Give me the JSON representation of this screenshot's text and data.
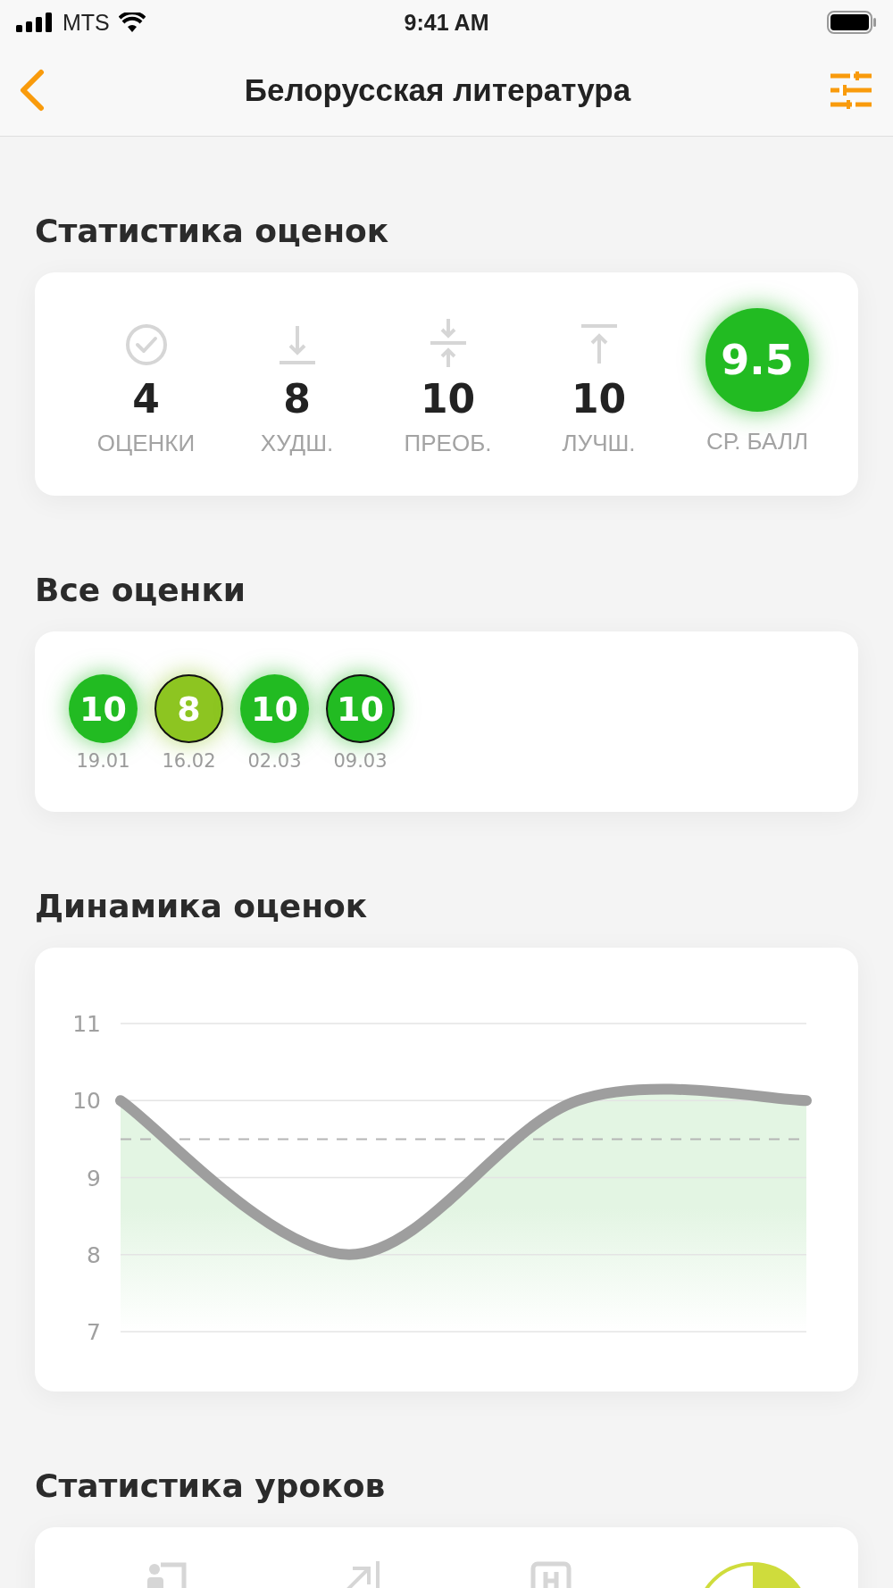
{
  "status_bar": {
    "carrier": "MTS",
    "time": "9:41 AM"
  },
  "nav": {
    "title": "Белорусская литература"
  },
  "grade_stats": {
    "title": "Статистика оценок",
    "items": [
      {
        "kind": "count",
        "value": "4",
        "label": "ОЦЕНКИ"
      },
      {
        "kind": "worst",
        "value": "8",
        "label": "ХУДШ."
      },
      {
        "kind": "mode",
        "value": "10",
        "label": "ПРЕОБ."
      },
      {
        "kind": "best",
        "value": "10",
        "label": "ЛУЧШ."
      },
      {
        "kind": "average",
        "value": "9.5",
        "label": "СР. БАЛЛ",
        "color": "#22bb22"
      }
    ]
  },
  "all_grades": {
    "title": "Все оценки",
    "items": [
      {
        "grade": "10",
        "date": "19.01",
        "color": "#22bb22",
        "outlined": false
      },
      {
        "grade": "8",
        "date": "16.02",
        "color": "#8dc521",
        "outlined": true
      },
      {
        "grade": "10",
        "date": "02.03",
        "color": "#22bb22",
        "outlined": false
      },
      {
        "grade": "10",
        "date": "09.03",
        "color": "#22bb22",
        "outlined": true
      }
    ]
  },
  "dynamics": {
    "title": "Динамика оценок",
    "chart_data": {
      "type": "area",
      "series": [
        {
          "color": "#9e9e9e",
          "values": [
            10,
            8,
            10,
            10
          ]
        }
      ],
      "ylim": [
        7,
        11
      ],
      "yticks": [
        7,
        8,
        9,
        10,
        11
      ],
      "grid": true,
      "ref_lines": [
        {
          "axis": "y",
          "value": 9.5
        }
      ]
    }
  },
  "lesson_stats": {
    "title": "Статистика уроков",
    "items": [
      {
        "kind": "present"
      },
      {
        "kind": "skipped"
      },
      {
        "kind": "calendar"
      },
      {
        "kind": "pie"
      }
    ]
  }
}
